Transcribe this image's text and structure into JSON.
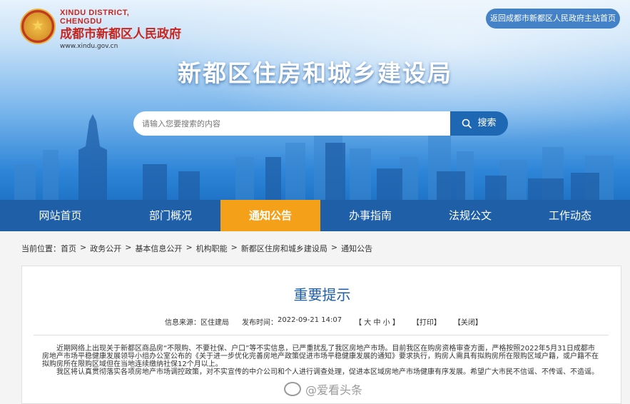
{
  "header": {
    "logo_en_1": "XINDU DISTRICT,",
    "logo_en_2": "CHENGDU",
    "logo_cn": "成都市新都区人民政府",
    "logo_url": "www.xindu.gov.cn",
    "back_link": "返回成都市新都区人民政府主站首页",
    "site_title": "新都区住房和城乡建设局"
  },
  "search": {
    "placeholder": "请输入您要搜索的内容",
    "button": "搜索"
  },
  "nav": {
    "items": [
      {
        "label": "网站首页"
      },
      {
        "label": "部门概况"
      },
      {
        "label": "通知公告"
      },
      {
        "label": "办事指南"
      },
      {
        "label": "法规公文"
      },
      {
        "label": "工作动态"
      }
    ],
    "active_index": 2
  },
  "breadcrumb": {
    "prefix": "当前位置：",
    "items": [
      "首页",
      "政务公开",
      "基本信息公开",
      "机构职能",
      "新都区住房和城乡建设局",
      "通知公告"
    ]
  },
  "article": {
    "title": "重要提示",
    "source_label": "信息来源：",
    "source": "区住建局",
    "time_label": "发布时间：",
    "time": "2022-09-21 14:07",
    "font_size_ctrl": "【 大  中  小 】",
    "print": "【打印】",
    "close": "【关闭】",
    "para1": "近期网络上出现关于新都区商品房“不限购、不要社保、户口”等不实信息，已严重扰乱了我区房地产市场。目前我区在购房资格审查方面，严格按照2022年5月31日成都市房地产市场平稳健康发展领导小组办公室公布的《关于进一步优化完善房地产政策促进市场平稳健康发展的通知》要求执行，购房人需具有拟购房所在限购区域户籍，或户籍不在拟购房所在限购区域但在当地连续缴纳社保12个月以上。",
    "para2": "我区将认真贯彻落实各项房地产市场调控政策，对不实宣传的中介公司和个人进行调查处理，促进本区域房地产市场健康有序发展。希望广大市民不信谣、不传谣、不造谣。"
  },
  "watermark": "@爱看头条",
  "colors": {
    "nav_bg": "#1f5fa8",
    "nav_active": "#f4a019",
    "title_blue": "#1d5ea8",
    "logo_red": "#c8261f"
  }
}
